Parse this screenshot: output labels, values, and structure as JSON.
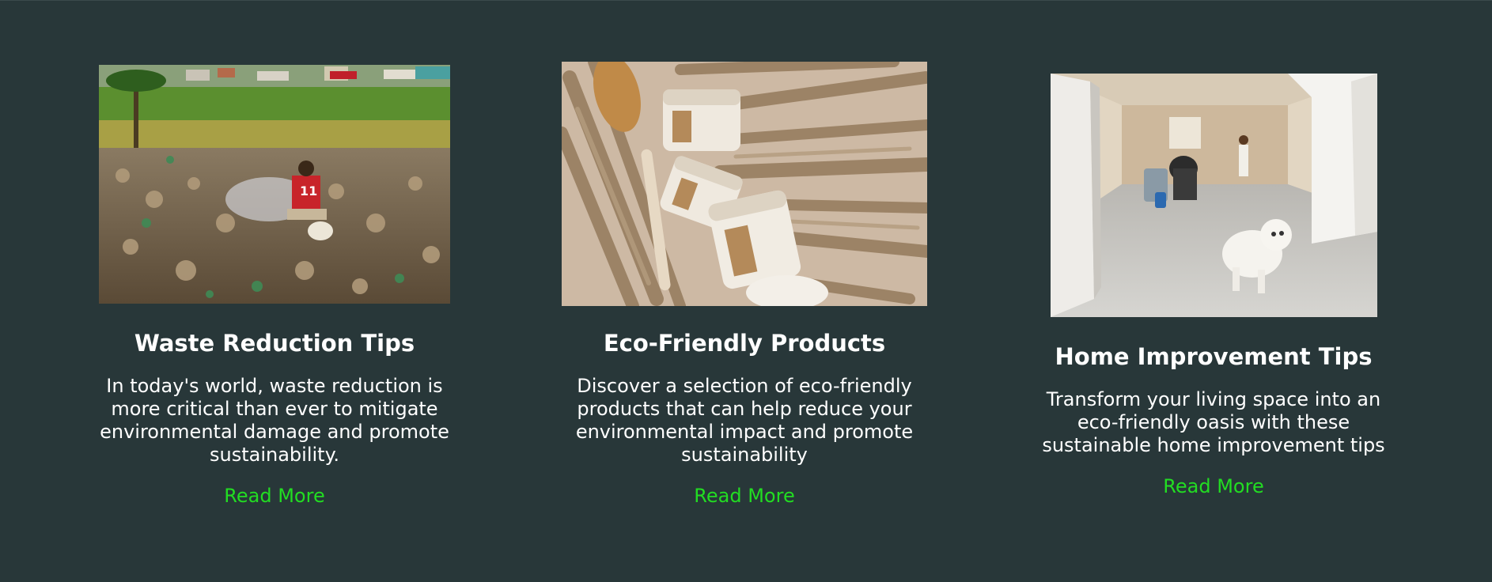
{
  "colors": {
    "background": "#283739",
    "text": "#ffffff",
    "link": "#22dd22"
  },
  "cards": [
    {
      "image": "recycling-dump-worker-photo",
      "title": "Waste Reduction Tips",
      "text": "In today's world, waste reduction is more critical than ever to mitigate environmental damage and promote sustainability.",
      "link_label": "Read More"
    },
    {
      "image": "eco-products-brush-jars-photo",
      "title": "Eco-Friendly Products",
      "text": "Discover a selection of eco-friendly products that can help reduce your environmental impact and promote sustainability",
      "link_label": "Read More"
    },
    {
      "image": "home-renovation-dog-photo",
      "title": "Home Improvement Tips",
      "text": "Transform your living space into an eco-friendly oasis with these sustainable home improvement tips",
      "link_label": "Read More"
    }
  ]
}
